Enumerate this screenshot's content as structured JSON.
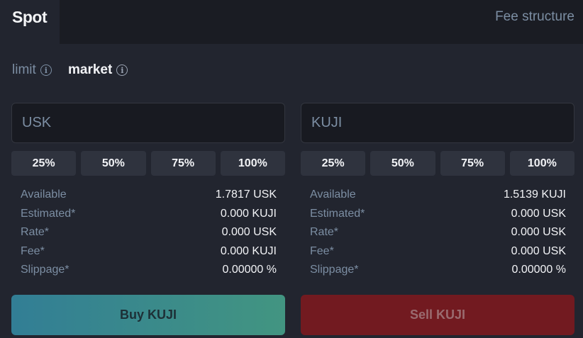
{
  "tabs": {
    "spot": "Spot",
    "fee_structure": "Fee structure"
  },
  "order_types": {
    "limit": "limit",
    "market": "market",
    "selected": "market"
  },
  "buy": {
    "input_placeholder": "USK",
    "percentages": [
      "25%",
      "50%",
      "75%",
      "100%"
    ],
    "stats": [
      {
        "label": "Available",
        "value": "1.7817 USK"
      },
      {
        "label": "Estimated*",
        "value": "0.000 KUJI"
      },
      {
        "label": "Rate*",
        "value": "0.000 USK"
      },
      {
        "label": "Fee*",
        "value": "0.000 KUJI"
      },
      {
        "label": "Slippage*",
        "value": "0.00000 %"
      }
    ],
    "button_label": "Buy KUJI"
  },
  "sell": {
    "input_placeholder": "KUJI",
    "percentages": [
      "25%",
      "50%",
      "75%",
      "100%"
    ],
    "stats": [
      {
        "label": "Available",
        "value": "1.5139 KUJI"
      },
      {
        "label": "Estimated*",
        "value": "0.000 USK"
      },
      {
        "label": "Rate*",
        "value": "0.000 USK"
      },
      {
        "label": "Fee*",
        "value": "0.000 USK"
      },
      {
        "label": "Slippage*",
        "value": "0.00000 %"
      }
    ],
    "button_label": "Sell KUJI"
  },
  "icons": {
    "order_type_info": "info-icon"
  },
  "colors": {
    "background": "#22252f",
    "header": "#1a1c23",
    "muted_text": "#7c8ea3",
    "buy_gradient_start": "#327e95",
    "buy_gradient_end": "#429581",
    "sell_button": "#721a20"
  }
}
